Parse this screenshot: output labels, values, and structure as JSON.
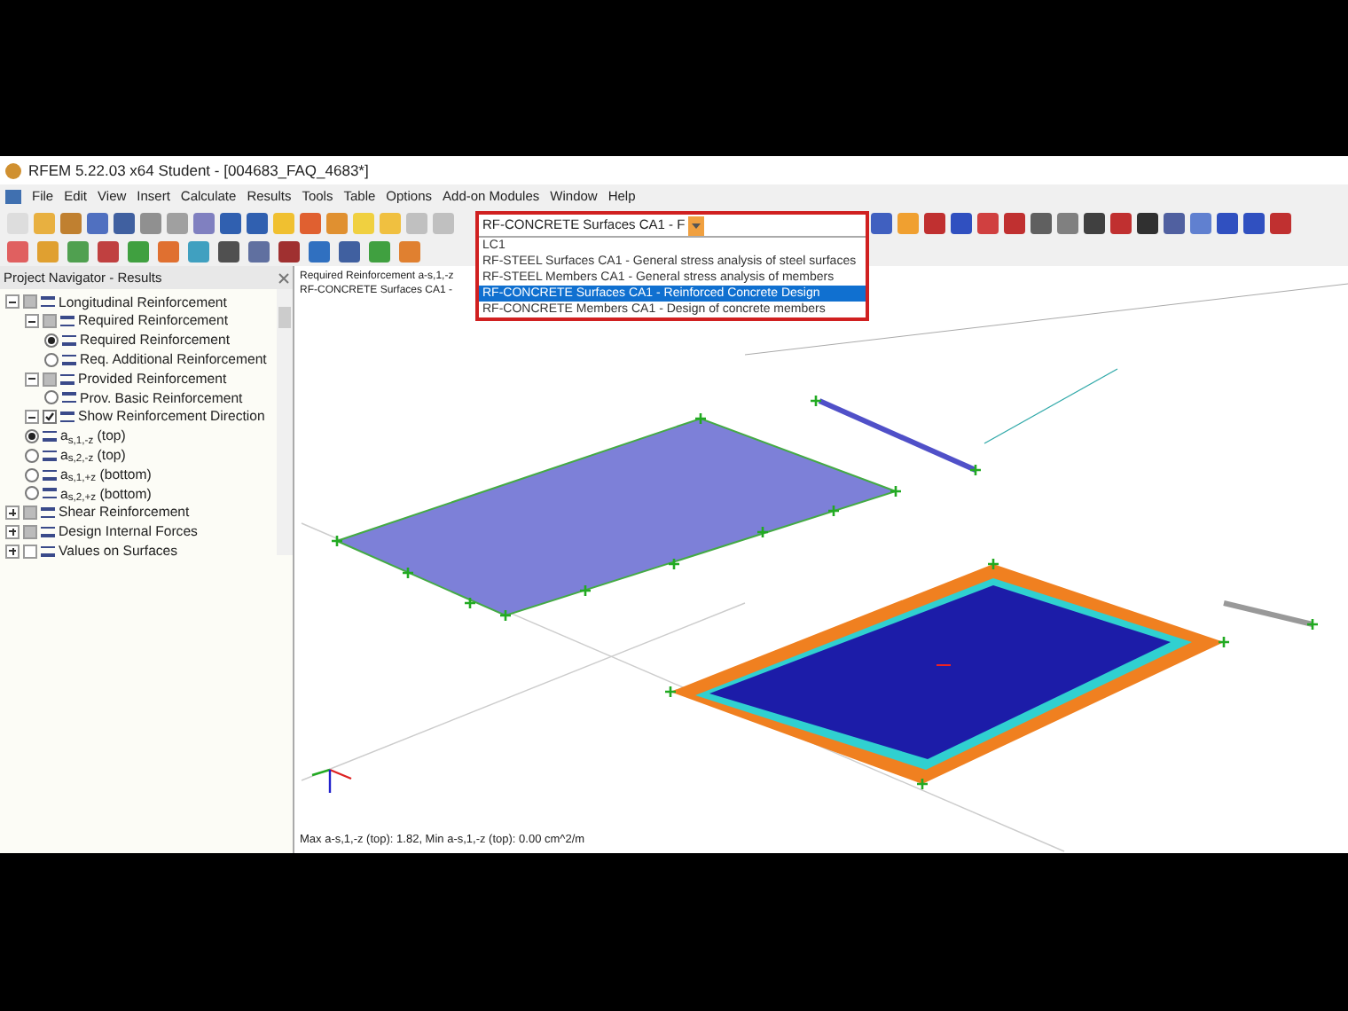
{
  "window": {
    "title": "RFEM 5.22.03 x64 Student - [004683_FAQ_4683*]"
  },
  "menu": [
    "File",
    "Edit",
    "View",
    "Insert",
    "Calculate",
    "Results",
    "Tools",
    "Table",
    "Options",
    "Add-on Modules",
    "Window",
    "Help"
  ],
  "case_selector": {
    "value": "RF-CONCRETE Surfaces CA1 - F",
    "options": [
      {
        "label": "LC1",
        "selected": false
      },
      {
        "label": "RF-STEEL Surfaces CA1 - General stress analysis of steel surfaces",
        "selected": false
      },
      {
        "label": "RF-STEEL Members CA1 - General stress analysis of members",
        "selected": false
      },
      {
        "label": "RF-CONCRETE Surfaces CA1 - Reinforced Concrete Design",
        "selected": true
      },
      {
        "label": "RF-CONCRETE Members CA1 - Design of concrete members",
        "selected": false
      }
    ]
  },
  "navigator": {
    "title": "Project Navigator - Results",
    "items": [
      {
        "kind": "group",
        "label": "Longitudinal Reinforcement",
        "expanded": true,
        "checked": true,
        "children": [
          {
            "kind": "group",
            "label": "Required Reinforcement",
            "expanded": true,
            "checked": true,
            "children": [
              {
                "kind": "radio",
                "label": "Required Reinforcement",
                "selected": true
              },
              {
                "kind": "radio",
                "label": "Req. Additional Reinforcement",
                "selected": false
              }
            ]
          },
          {
            "kind": "group",
            "label": "Provided Reinforcement",
            "expanded": true,
            "checked": true,
            "children": [
              {
                "kind": "radio",
                "label": "Prov. Basic Reinforcement",
                "selected": false
              }
            ]
          },
          {
            "kind": "check",
            "label": "Show Reinforcement Direction",
            "expanded": true,
            "checked": true
          },
          {
            "kind": "radio",
            "label": "a$_{s,1,-z}$ (top)",
            "selected": true
          },
          {
            "kind": "radio",
            "label": "a$_{s,2,-z}$ (top)",
            "selected": false
          },
          {
            "kind": "radio",
            "label": "a$_{s,1,+z}$ (bottom)",
            "selected": false
          },
          {
            "kind": "radio",
            "label": "a$_{s,2,+z}$ (bottom)",
            "selected": false
          }
        ]
      },
      {
        "kind": "group",
        "label": "Shear Reinforcement",
        "expanded": false,
        "checked": true
      },
      {
        "kind": "group",
        "label": "Design Internal Forces",
        "expanded": false,
        "checked": true
      },
      {
        "kind": "group",
        "label": "Values on Surfaces",
        "expanded": false,
        "checked": false
      }
    ]
  },
  "viewport": {
    "header": [
      "Required Reinforcement a-s,1,-z",
      "RF-CONCRETE Surfaces CA1 -"
    ],
    "footer": "Max a-s,1,-z (top): 1.82, Min a-s,1,-z (top): 0.00 cm^2/m"
  }
}
